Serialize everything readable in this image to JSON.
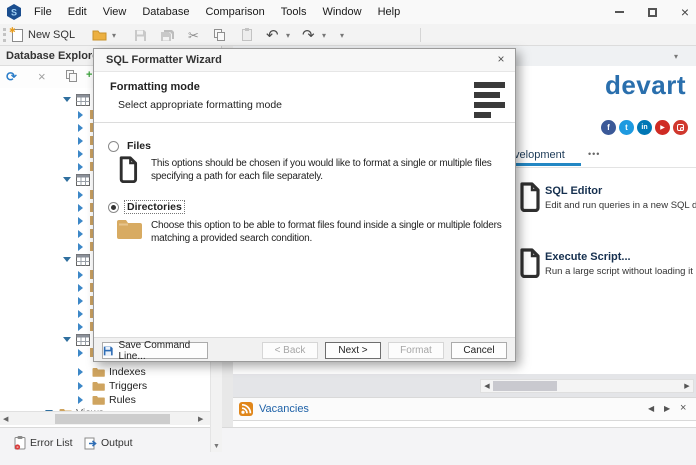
{
  "titlebar": {
    "menu": [
      "File",
      "Edit",
      "View",
      "Database",
      "Comparison",
      "Tools",
      "Window",
      "Help"
    ]
  },
  "toolbar": {
    "new_sql": "New SQL"
  },
  "icons": {
    "close": "×",
    "refresh": "⟳",
    "cut": "✂",
    "undo": "↶",
    "redo": "↷",
    "caret": "▾",
    "nav_left": "◀",
    "nav_right": "▶",
    "more": "•••",
    "play": "▶"
  },
  "explorer": {
    "title": "Database Explorer -",
    "visible_items": [
      {
        "label": "Indexes"
      },
      {
        "label": "Triggers"
      },
      {
        "label": "Rules"
      },
      {
        "label": "Views"
      }
    ]
  },
  "dialog": {
    "title": "SQL Formatter Wizard",
    "heading": "Formatting mode",
    "subheading": "Select appropriate formatting mode",
    "options": [
      {
        "label": "Files",
        "selected": false,
        "description": "This options should be chosen if you would like to format a single or multiple files specifying a path for each file separately."
      },
      {
        "label": "Directories",
        "selected": true,
        "description": "Choose this option to be able to format files found inside a single or multiple folders matching a provided search condition."
      }
    ],
    "footer": {
      "save_cmd": "Save Command Line...",
      "back": "< Back",
      "next": "Next >",
      "format": "Format",
      "cancel": "Cancel"
    }
  },
  "start_page": {
    "brand": "devart",
    "tab_label": "Development",
    "shortcuts": [
      {
        "title": "SQL Editor",
        "description": "Edit and run queries in a new SQL document"
      },
      {
        "title": "Execute Script...",
        "description": "Run a large script without loading it into memory"
      }
    ],
    "social": [
      {
        "name": "facebook",
        "glyph": "f",
        "color": "#3b5998"
      },
      {
        "name": "twitter",
        "glyph": "t",
        "color": "#1e9ae0"
      },
      {
        "name": "linkedin",
        "glyph": "in",
        "color": "#0077b5"
      },
      {
        "name": "youtube",
        "glyph": "▶",
        "color": "#cf2b24"
      },
      {
        "name": "instagram",
        "glyph": "",
        "color": "#d0382e"
      }
    ],
    "feed_tab": "Vacancies"
  },
  "bottom_bar": {
    "tabs": [
      {
        "label": "Error List"
      },
      {
        "label": "Output"
      }
    ]
  },
  "colors": {
    "brand_blue": "#2a6fad",
    "tab_underline": "#2387c4",
    "folder_tan": "#cfa45f",
    "chevron_blue": "#3c87c7",
    "rss_orange": "#e0861a",
    "link_blue": "#1f62a8"
  }
}
